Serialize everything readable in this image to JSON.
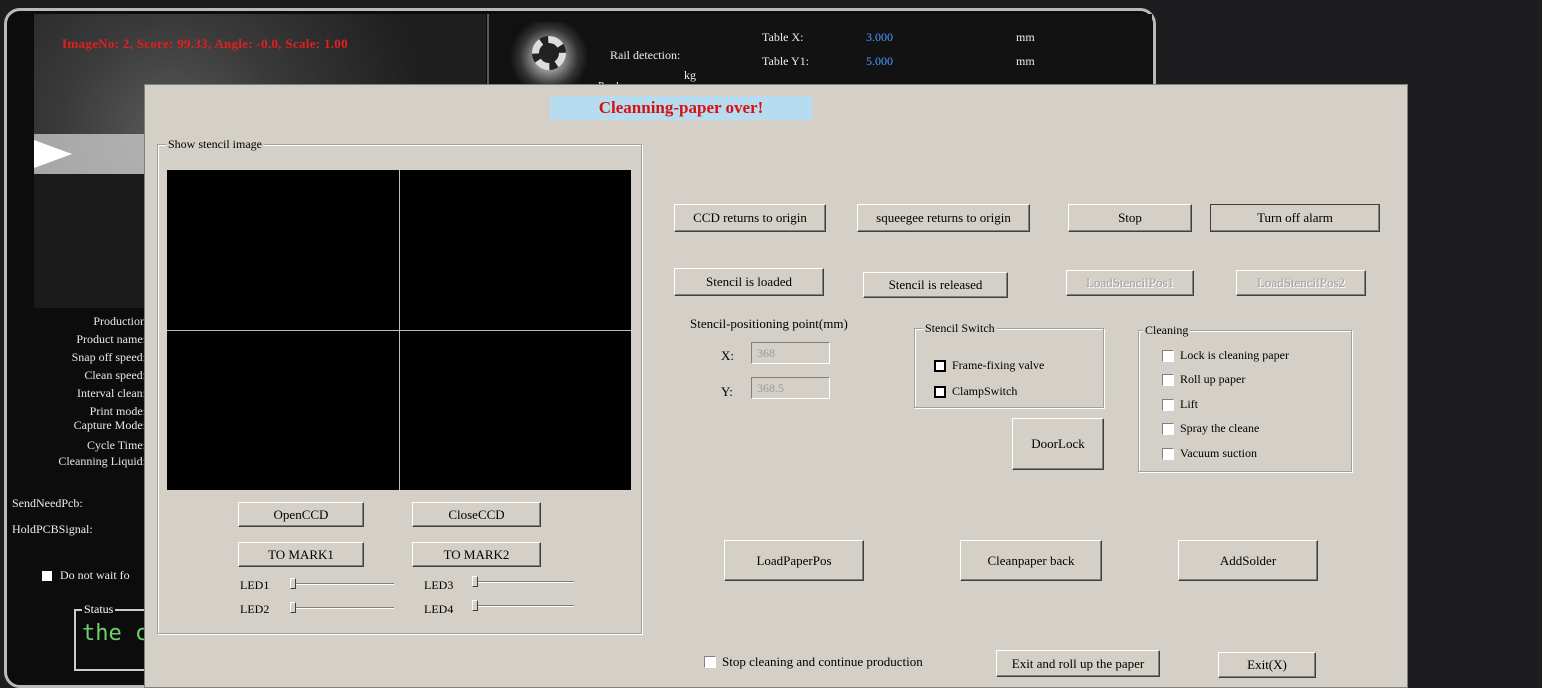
{
  "background": {
    "camera_overlay": "ImageNo: 2, Score: 99.33, Angle: -0.0, Scale: 1.00",
    "logo_text": "Produce",
    "rail_detection_label": "Rail detection:",
    "weight_unit": "kg",
    "table_x_label": "Table X:",
    "table_x_value": "3.000",
    "table_x_unit": "mm",
    "table_y1_label": "Table Y1:",
    "table_y1_value": "5.000",
    "table_y1_unit": "mm",
    "left_fields": [
      "Production",
      "Product name:",
      "Snap off speed:",
      "Clean speed:",
      "Interval clean:",
      "Print mode:",
      "Capture Mode:",
      "Cycle Time:",
      "Cleanning Liquid:"
    ],
    "send_need_pcb": "SendNeedPcb:",
    "hold_pcb_signal": "HoldPCBSignal:",
    "do_not_wait": "Do not wait fo",
    "status_title": "Status",
    "status_text": "the c"
  },
  "dialog": {
    "banner": "Cleanning-paper over!",
    "stencil_group_title": "Show stencil image",
    "open_ccd": "OpenCCD",
    "close_ccd": "CloseCCD",
    "to_mark1": "TO MARK1",
    "to_mark2": "TO MARK2",
    "led1": "LED1",
    "led2": "LED2",
    "led3": "LED3",
    "led4": "LED4",
    "ccd_origin": "CCD returns to origin",
    "squeegee_origin": "squeegee returns to origin",
    "stop": "Stop",
    "turn_off_alarm": "Turn off alarm",
    "stencil_loaded": "Stencil is loaded",
    "stencil_released": "Stencil is released",
    "load_stencil_pos1": "LoadStencilPos1",
    "load_stencil_pos2": "LoadStencilPos2",
    "positioning_title": "Stencil-positioning point(mm)",
    "x_label": "X:",
    "x_value": "368",
    "y_label": "Y:",
    "y_value": "368.5",
    "stencil_switch_title": "Stencil Switch",
    "frame_fixing_valve": "Frame-fixing valve",
    "clamp_switch": "ClampSwitch",
    "door_lock": "DoorLock",
    "cleaning_title": "Cleaning",
    "cleaning_options": [
      "Lock is cleaning paper",
      "Roll up paper",
      "Lift",
      "Spray the cleane",
      "Vacuum suction"
    ],
    "load_paper_pos": "LoadPaperPos",
    "cleanpaper_back": "Cleanpaper back",
    "add_solder": "AddSolder",
    "stop_cleaning_continue": "Stop cleaning and continue production",
    "exit_roll_up": "Exit and roll up the paper",
    "exit": "Exit(X)"
  },
  "colors": {
    "dialog_bg": "#d4d0c8",
    "banner_bg": "#b8dcef",
    "banner_text": "#d81010",
    "status_text": "#6bd16b",
    "value_blue": "#4f9bff"
  }
}
